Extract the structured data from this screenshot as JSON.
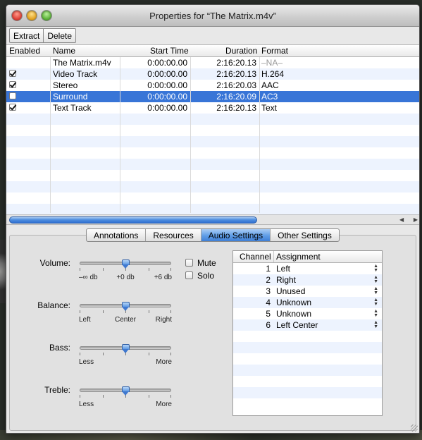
{
  "window": {
    "title": "Properties for “The Matrix.m4v”"
  },
  "toolbar": {
    "extract_label": "Extract",
    "delete_label": "Delete"
  },
  "tracks": {
    "headers": {
      "enabled": "Enabled",
      "name": "Name",
      "start": "Start Time",
      "duration": "Duration",
      "format": "Format"
    },
    "rows": [
      {
        "checkbox": "none",
        "name": "The Matrix.m4v",
        "start": "0:00:00.00",
        "duration": "2:16:20.13",
        "format": "–NA–",
        "selected": false
      },
      {
        "checkbox": "checked",
        "name": "Video Track",
        "start": "0:00:00.00",
        "duration": "2:16:20.13",
        "format": "H.264",
        "selected": false
      },
      {
        "checkbox": "checked",
        "name": "Stereo",
        "start": "0:00:00.00",
        "duration": "2:16:20.03",
        "format": "AAC",
        "selected": false
      },
      {
        "checkbox": "unchecked",
        "name": "Surround",
        "start": "0:00:00.00",
        "duration": "2:16:20.09",
        "format": "AC3",
        "selected": true
      },
      {
        "checkbox": "checked",
        "name": "Text Track",
        "start": "0:00:00.00",
        "duration": "2:16:20.13",
        "format": "Text",
        "selected": false
      }
    ]
  },
  "tabs": {
    "annotations": "Annotations",
    "resources": "Resources",
    "audio_settings": "Audio Settings",
    "other_settings": "Other Settings",
    "active": "audio_settings"
  },
  "audio": {
    "volume": {
      "label": "Volume:",
      "min": "–∞ db",
      "mid": "+0 db",
      "max": "+6 db",
      "value": "+0 db"
    },
    "balance": {
      "label": "Balance:",
      "min": "Left",
      "mid": "Center",
      "max": "Right",
      "value": "Center"
    },
    "bass": {
      "label": "Bass:",
      "min": "Less",
      "max": "More",
      "value": "center"
    },
    "treble": {
      "label": "Treble:",
      "min": "Less",
      "max": "More",
      "value": "center"
    },
    "mute_label": "Mute",
    "solo_label": "Solo",
    "mute": false,
    "solo": false
  },
  "channels": {
    "headers": {
      "channel": "Channel",
      "assignment": "Assignment"
    },
    "rows": [
      {
        "channel": "1",
        "assignment": "Left"
      },
      {
        "channel": "2",
        "assignment": "Right"
      },
      {
        "channel": "3",
        "assignment": "Unused"
      },
      {
        "channel": "4",
        "assignment": "Unknown"
      },
      {
        "channel": "5",
        "assignment": "Unknown"
      },
      {
        "channel": "6",
        "assignment": "Left Center"
      }
    ]
  },
  "colors": {
    "selection": "#3875d7",
    "active_tab": "#5f9de6",
    "alt_row": "#edf3fe"
  }
}
